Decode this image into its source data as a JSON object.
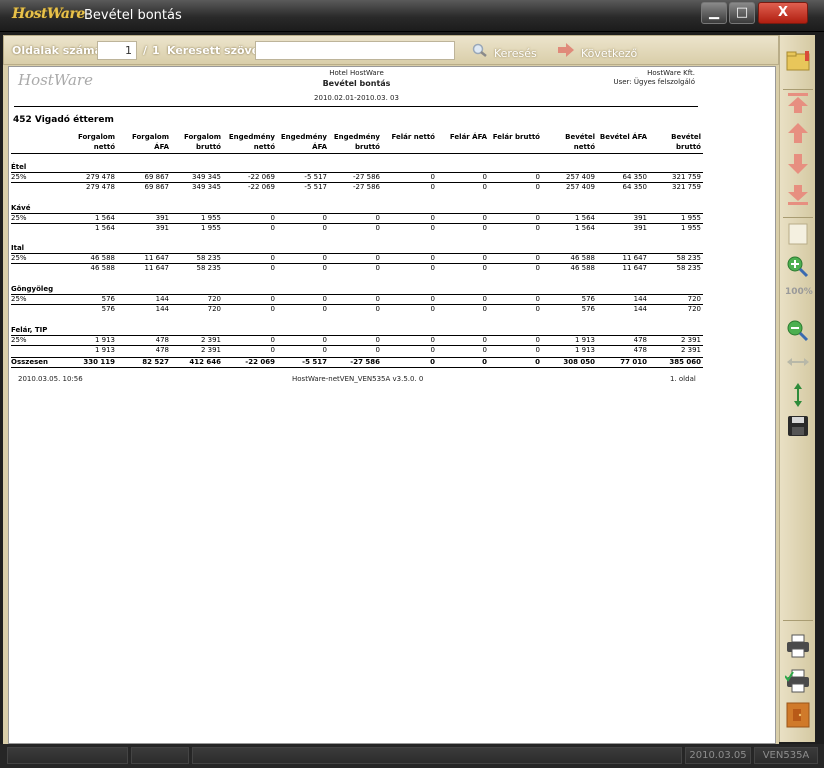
{
  "window": {
    "logo": "HostWare",
    "title": "Bevétel bontás",
    "minimize": "▁",
    "maximize": "□",
    "close": "X"
  },
  "toolbar": {
    "pages_label": "Oldalak száma:",
    "current_page": "1",
    "page_separator": "/",
    "total_pages": "1",
    "search_label": "Keresett szöveg:",
    "search_value": "",
    "search_button": "Keresés",
    "next_button": "Következő"
  },
  "sidebar": {
    "icons": [
      "folder-icon",
      "first-page-icon",
      "previous-page-icon",
      "next-page-icon",
      "last-page-icon",
      "page-view-icon",
      "zoom-in-icon",
      "zoom-100-icon",
      "zoom-out-icon",
      "fit-width-icon",
      "fit-height-icon",
      "save-icon",
      "print-icon",
      "print-setup-icon",
      "exit-icon"
    ],
    "zoom_100_label": "100%"
  },
  "report": {
    "logo": "HostWare",
    "hotel": "Hotel HostWare",
    "title": "Bevétel bontás",
    "company": "HostWare Kft.",
    "user": "User: Ügyes felszolgáló",
    "period": "2010.02.01-2010.03. 03",
    "restaurant": "452 Vigadó étterem",
    "columns": [
      [
        "Forgalom",
        "nettó"
      ],
      [
        "Forgalom",
        "ÁFA"
      ],
      [
        "Forgalom",
        "bruttó"
      ],
      [
        "Engedmény",
        "nettó"
      ],
      [
        "Engedmény",
        "ÁFA"
      ],
      [
        "Engedmény",
        "bruttó"
      ],
      [
        "Felár nettó",
        ""
      ],
      [
        "Felár ÁFA",
        ""
      ],
      [
        "Felár bruttó",
        ""
      ],
      [
        "Bevétel",
        "nettó"
      ],
      [
        "Bevétel ÁFA",
        ""
      ],
      [
        "Bevétel",
        "bruttó"
      ]
    ],
    "groups": [
      {
        "name": "Étel",
        "rate": "25%",
        "row": [
          "279 478",
          "69 867",
          "349 345",
          "-22 069",
          "-5 517",
          "-27 586",
          "0",
          "0",
          "0",
          "257 409",
          "64 350",
          "321 759"
        ],
        "subtotal": [
          "279 478",
          "69 867",
          "349 345",
          "-22 069",
          "-5 517",
          "-27 586",
          "0",
          "0",
          "0",
          "257 409",
          "64 350",
          "321 759"
        ]
      },
      {
        "name": "Kávé",
        "rate": "25%",
        "row": [
          "1 564",
          "391",
          "1 955",
          "0",
          "0",
          "0",
          "0",
          "0",
          "0",
          "1 564",
          "391",
          "1 955"
        ],
        "subtotal": [
          "1 564",
          "391",
          "1 955",
          "0",
          "0",
          "0",
          "0",
          "0",
          "0",
          "1 564",
          "391",
          "1 955"
        ]
      },
      {
        "name": "Ital",
        "rate": "25%",
        "row": [
          "46 588",
          "11 647",
          "58 235",
          "0",
          "0",
          "0",
          "0",
          "0",
          "0",
          "46 588",
          "11 647",
          "58 235"
        ],
        "subtotal": [
          "46 588",
          "11 647",
          "58 235",
          "0",
          "0",
          "0",
          "0",
          "0",
          "0",
          "46 588",
          "11 647",
          "58 235"
        ]
      },
      {
        "name": "Göngyöleg",
        "rate": "25%",
        "row": [
          "576",
          "144",
          "720",
          "0",
          "0",
          "0",
          "0",
          "0",
          "0",
          "576",
          "144",
          "720"
        ],
        "subtotal": [
          "576",
          "144",
          "720",
          "0",
          "0",
          "0",
          "0",
          "0",
          "0",
          "576",
          "144",
          "720"
        ]
      },
      {
        "name": "Felár, TIP",
        "rate": "25%",
        "row": [
          "1 913",
          "478",
          "2 391",
          "0",
          "0",
          "0",
          "0",
          "0",
          "0",
          "1 913",
          "478",
          "2 391"
        ],
        "subtotal": [
          "1 913",
          "478",
          "2 391",
          "0",
          "0",
          "0",
          "0",
          "0",
          "0",
          "1 913",
          "478",
          "2 391"
        ]
      }
    ],
    "total_label": "Összesen",
    "total": [
      "330 119",
      "82 527",
      "412 646",
      "-22 069",
      "-5 517",
      "-27 586",
      "0",
      "0",
      "0",
      "308 050",
      "77 010",
      "385 060"
    ],
    "footer": {
      "printed": "2010.03.05.  10:56",
      "version": "HostWare-netVEN_VEN535A   v3.5.0. 0",
      "page": "1. oldal"
    }
  },
  "statusbar": {
    "date": "2010.03.05",
    "module": "VEN535A"
  }
}
